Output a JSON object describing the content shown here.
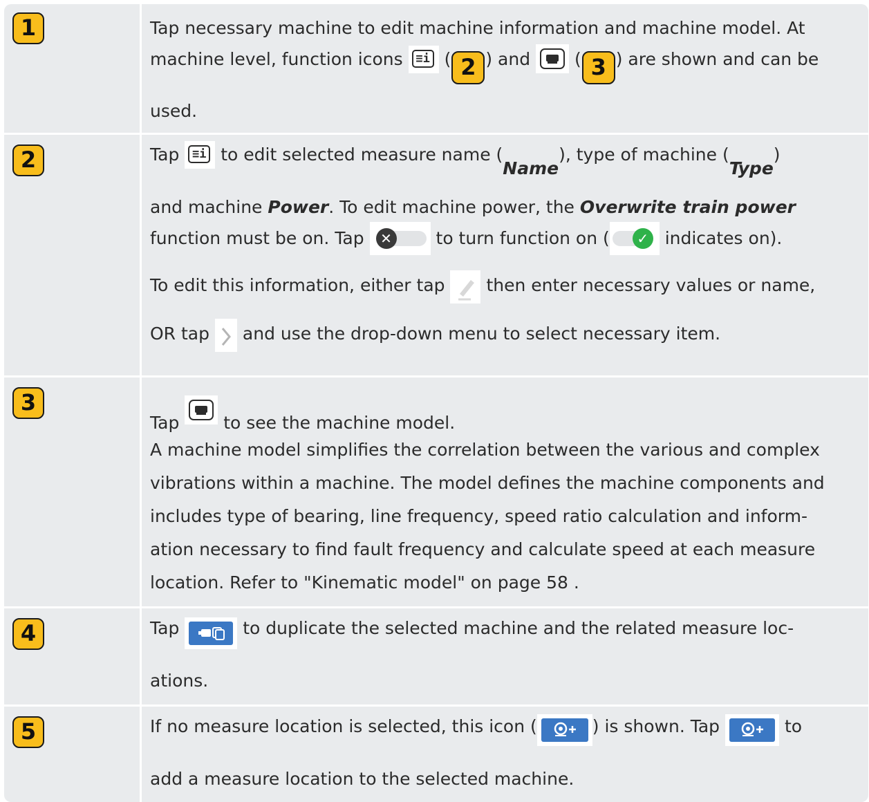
{
  "rows": [
    {
      "badge": "1",
      "line1": "Tap necessary machine to edit machine information and machine model. At",
      "line2_a": "machine level, function icons",
      "line2_paren_open_1": "(",
      "line2_badge_1": "2",
      "line2_b": ") and",
      "line2_paren_open_2": "(",
      "line2_badge_2": "3",
      "line2_c": ") are shown and can be",
      "line3": "used."
    },
    {
      "badge": "2",
      "l1_a": "Tap",
      "l1_b": "to edit selected measure name (",
      "l1_name": "Name",
      "l1_c": "), type of machine (",
      "l1_type": "Type",
      "l1_d": ")",
      "l2_a": "and machine ",
      "l2_power": "Power",
      "l2_b": ". To edit machine power, the ",
      "l2_overwrite": "Overwrite train power",
      "l3_a": "function must be on. Tap",
      "l3_b": "to turn function on (",
      "l3_c": "indicates on).",
      "l4_a": "To edit this information, either tap",
      "l4_b": "then enter necessary values or name,",
      "l5_a": "OR tap",
      "l5_b": "and use the drop-down menu to select necessary item."
    },
    {
      "badge": "3",
      "l1_a": "Tap",
      "l1_b": "to see the machine model.",
      "paragraph": [
        "A machine model simplifies the correlation between the various and complex",
        "vibrations within a machine. The model defines the machine components and",
        "includes type of bearing, line frequency, speed ratio calculation and inform-",
        "ation necessary to find fault frequency and calculate speed at each measure",
        "location. Refer to \"Kinematic model\" on page 58 ."
      ]
    },
    {
      "badge": "4",
      "l1_a": "Tap",
      "l1_b": "to duplicate the selected machine and the related measure loc-",
      "l2": "ations."
    },
    {
      "badge": "5",
      "l1_a": "If no measure location is selected, this icon (",
      "l1_b": ") is shown. Tap",
      "l1_c": "to",
      "l2": "add a measure location to the selected machine."
    }
  ],
  "icons": {
    "info": "machine-info-icon",
    "model": "machine-model-icon",
    "toggle_off": "toggle-off-icon",
    "toggle_on": "toggle-on-icon",
    "pencil": "pencil-icon",
    "chevron": "chevron-right-icon",
    "duplicate": "duplicate-machine-icon",
    "add_location": "add-measure-location-icon"
  },
  "colors": {
    "badge": "#f8bd1c",
    "row_bg": "#e9ebed",
    "button_blue": "#3b78c4",
    "toggle_off_knob": "#3a3a3a",
    "toggle_on_knob": "#2fb24a"
  }
}
